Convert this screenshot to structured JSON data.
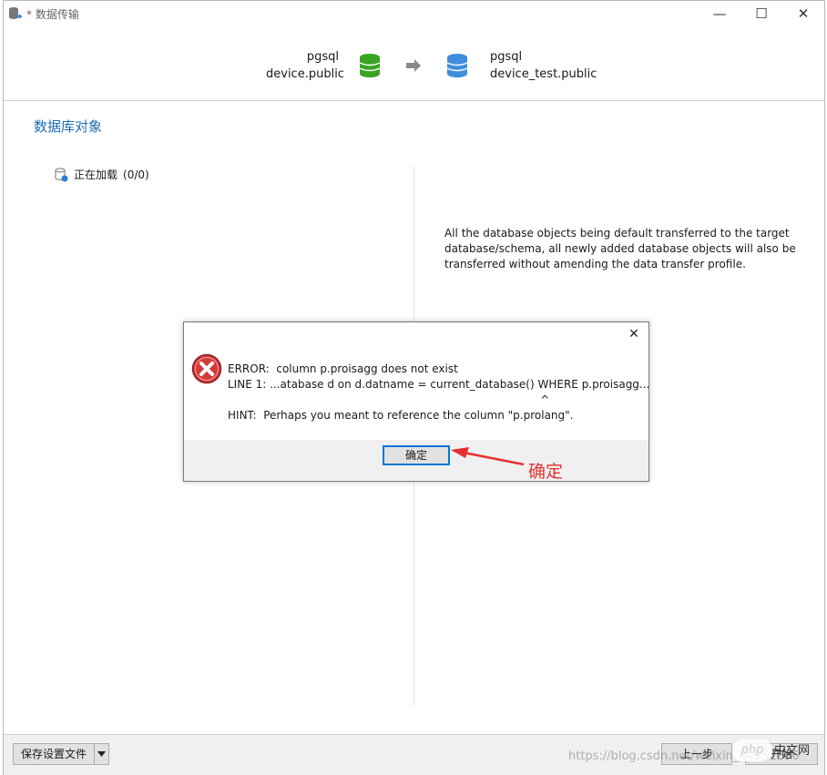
{
  "window": {
    "title": "* 数据传输",
    "icon": "database-transfer-icon"
  },
  "header": {
    "source": {
      "connection": "pgsql",
      "database": "device.public",
      "color": "#3aa424"
    },
    "target": {
      "connection": "pgsql",
      "database": "device_test.public",
      "color": "#3f8fde"
    }
  },
  "section": {
    "title": "数据库对象"
  },
  "tree": {
    "loading_label": "正在加载",
    "count": "(0/0)"
  },
  "info": {
    "text": "All the database objects being default transferred to the target database/schema, all newly added database objects will also be transferred without amending the data transfer profile."
  },
  "dialog": {
    "close_label": "✕",
    "message": "ERROR:  column p.proisagg does not exist\nLINE 1: ...atabase d on d.datname = current_database() WHERE p.proisagg...\n                                                                                          ^\nHINT:  Perhaps you meant to reference the column \"p.prolang\".",
    "ok_label": "确定"
  },
  "annotation": {
    "label": "确定",
    "color": "#e53030"
  },
  "footer": {
    "save_profile_label": "保存设置文件",
    "prev_label": "上一步",
    "start_label": "开始",
    "watermark": "https://blog.csdn.net/weixin_44351696",
    "php_logo": "php",
    "php_cn": "中文网"
  }
}
